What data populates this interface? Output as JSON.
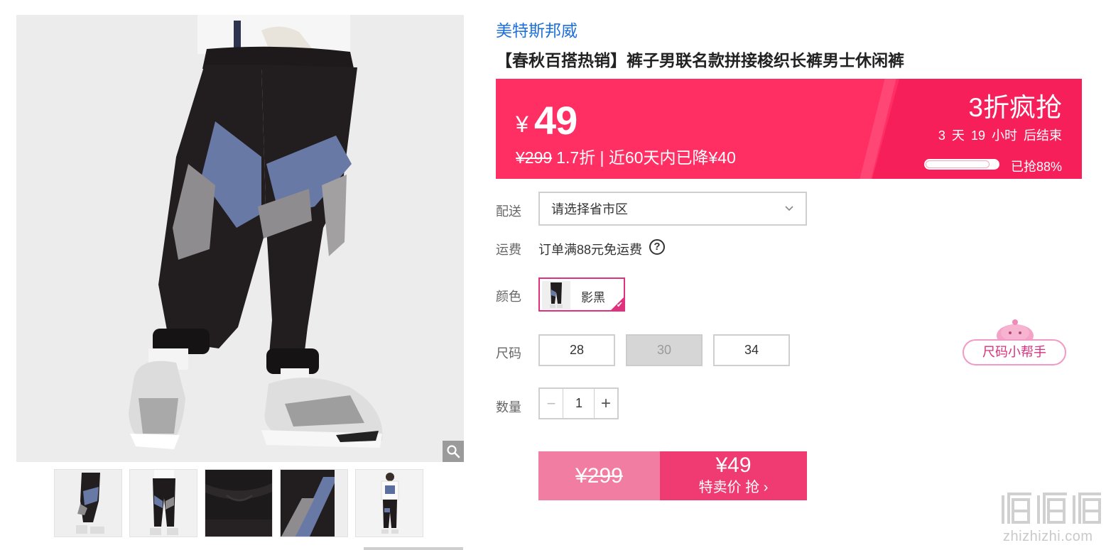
{
  "product": {
    "brand": "美特斯邦威",
    "title": "【春秋百搭热销】裤子男联名款拼接梭织长裤男士休闲裤"
  },
  "price_banner": {
    "currency": "¥",
    "price": "49",
    "original_price": "¥299",
    "discount_info": "1.7折 | 近60天内已降¥40",
    "promo_title": "3折疯抢",
    "countdown": {
      "days": "3",
      "days_unit": "天",
      "hours": "19",
      "hours_unit": "小时",
      "suffix": "后结束"
    },
    "sold_percent": 88,
    "sold_label": "已抢88%",
    "colors": {
      "main": "#ff2e63",
      "panel": "#f71f59"
    }
  },
  "delivery": {
    "label": "配送",
    "region_placeholder": "请选择省市区"
  },
  "shipping": {
    "label": "运费",
    "text": "订单满88元免运费"
  },
  "color": {
    "label": "颜色",
    "options": [
      {
        "name": "影黑",
        "selected": true
      }
    ],
    "selected_border": "#e0317c"
  },
  "size": {
    "label": "尺码",
    "options": [
      {
        "value": "28",
        "disabled": false
      },
      {
        "value": "30",
        "disabled": true
      },
      {
        "value": "34",
        "disabled": false
      }
    ],
    "helper": "尺码小帮手"
  },
  "quantity": {
    "label": "数量",
    "value": "1",
    "minus": "−",
    "plus": "+"
  },
  "buy_box": {
    "original_price": "¥299",
    "price": "¥49",
    "cta": "特卖价 抢 ›"
  },
  "gallery": {
    "thumbnails": [
      "full-body-side",
      "full-body-front",
      "waistband-detail",
      "panel-detail",
      "model-full"
    ]
  },
  "watermark": {
    "url": "zhizhizhi.com"
  }
}
